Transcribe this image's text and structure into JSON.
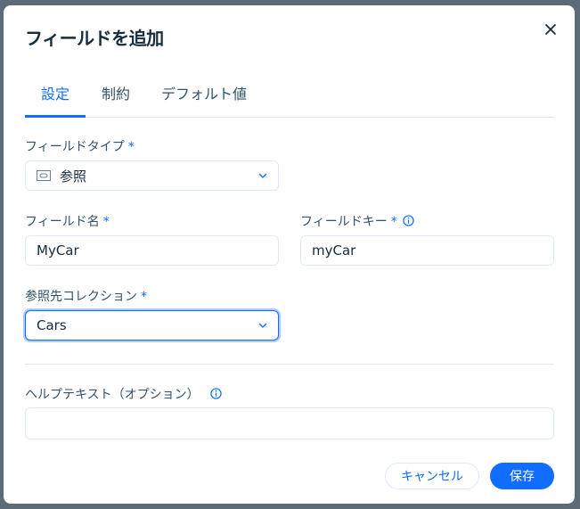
{
  "dialog": {
    "title": "フィールドを追加",
    "close_icon": "close-icon"
  },
  "tabs": [
    {
      "label": "設定",
      "active": true
    },
    {
      "label": "制約",
      "active": false
    },
    {
      "label": "デフォルト値",
      "active": false
    }
  ],
  "fields": {
    "field_type": {
      "label": "フィールドタイプ",
      "required_mark": "*",
      "icon": "reference-link-icon",
      "value": "参照"
    },
    "field_name": {
      "label": "フィールド名",
      "required_mark": "*",
      "value": "MyCar"
    },
    "field_key": {
      "label": "フィールドキー",
      "required_mark": "*",
      "info_icon": "info-icon",
      "value": "myCar"
    },
    "reference_collection": {
      "label": "参照先コレクション",
      "required_mark": "*",
      "value": "Cars"
    },
    "help_text": {
      "label": "ヘルプテキスト（オプション）",
      "info_icon": "info-icon",
      "value": "",
      "placeholder": ""
    }
  },
  "buttons": {
    "cancel": "キャンセル",
    "save": "保存"
  },
  "colors": {
    "accent": "#116dff",
    "text": "#162d3d",
    "label": "#32536a",
    "backdrop": "#5d6b76"
  }
}
